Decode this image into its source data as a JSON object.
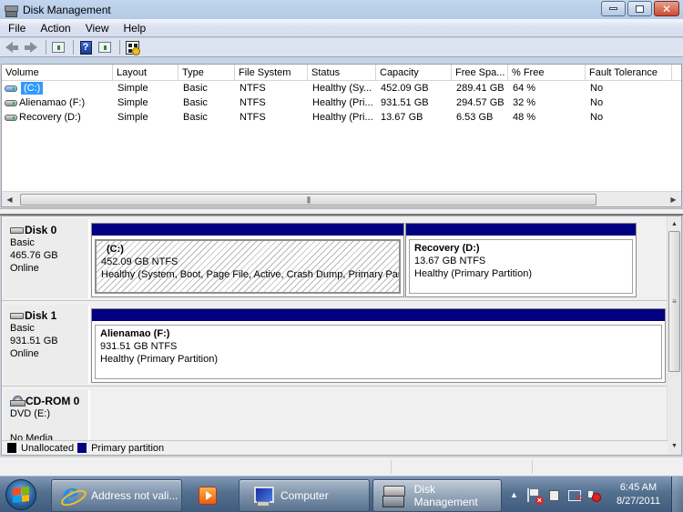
{
  "window": {
    "title": "Disk Management",
    "controls": {
      "minimize": "minimize",
      "restore": "restore",
      "close": "close"
    }
  },
  "menu": [
    "File",
    "Action",
    "View",
    "Help"
  ],
  "toolbar": {
    "icons": [
      "back-arrow-icon",
      "forward-arrow-icon",
      "show-hide-console-tree-icon",
      "help-icon",
      "show-hide-action-pane-icon",
      "properties-icon"
    ]
  },
  "volume_list": {
    "columns": [
      "Volume",
      "Layout",
      "Type",
      "File System",
      "Status",
      "Capacity",
      "Free Spa...",
      "% Free",
      "Fault Tolerance"
    ],
    "rows": [
      {
        "volume": "(C:)",
        "layout": "Simple",
        "type": "Basic",
        "fs": "NTFS",
        "status": "Healthy (Sy...",
        "capacity": "452.09 GB",
        "free": "289.41 GB",
        "pct_free": "64 %",
        "fault": "No",
        "selected": true
      },
      {
        "volume": "Alienamao (F:)",
        "layout": "Simple",
        "type": "Basic",
        "fs": "NTFS",
        "status": "Healthy (Pri...",
        "capacity": "931.51 GB",
        "free": "294.57 GB",
        "pct_free": "32 %",
        "fault": "No",
        "selected": false
      },
      {
        "volume": "Recovery (D:)",
        "layout": "Simple",
        "type": "Basic",
        "fs": "NTFS",
        "status": "Healthy (Pri...",
        "capacity": "13.67 GB",
        "free": "6.53 GB",
        "pct_free": "48 %",
        "fault": "No",
        "selected": false
      }
    ]
  },
  "disks": [
    {
      "name": "Disk 0",
      "kind": "Basic",
      "size": "465.76 GB",
      "state": "Online",
      "partitions": [
        {
          "name": "(C:)",
          "size_fs": "452.09 GB NTFS",
          "status": "Healthy (System, Boot, Page File, Active, Crash Dump, Primary Part",
          "selected": true
        },
        {
          "name": "Recovery  (D:)",
          "size_fs": "13.67 GB NTFS",
          "status": "Healthy (Primary Partition)",
          "selected": false
        }
      ]
    },
    {
      "name": "Disk 1",
      "kind": "Basic",
      "size": "931.51 GB",
      "state": "Online",
      "partitions": [
        {
          "name": "Alienamao  (F:)",
          "size_fs": "931.51 GB NTFS",
          "status": "Healthy (Primary Partition)",
          "selected": false
        }
      ]
    },
    {
      "name": "CD-ROM 0",
      "kind": "DVD (E:)",
      "state": "No Media"
    }
  ],
  "legend": [
    {
      "label": "Unallocated",
      "color": "#000000"
    },
    {
      "label": "Primary partition",
      "color": "#000080"
    }
  ],
  "taskbar": {
    "buttons": [
      {
        "label": "Address not vali...",
        "icon": "internet-explorer-icon"
      },
      {
        "label": "Computer",
        "icon": "computer-icon"
      },
      {
        "label": "Disk Management",
        "icon": "disk-management-icon",
        "active": true
      }
    ],
    "pinned": [
      "windows-media-player-icon"
    ],
    "clock": {
      "time": "6:45 AM",
      "date": "8/27/2011"
    }
  }
}
